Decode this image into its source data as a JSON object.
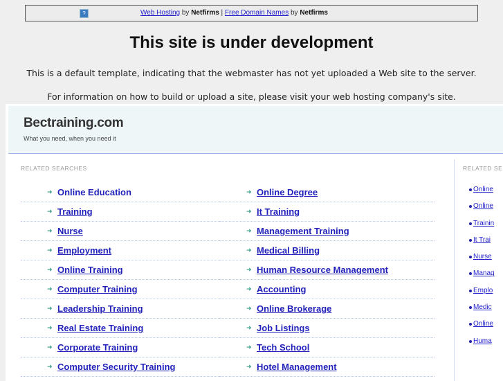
{
  "topbar": {
    "help_icon": "question-icon",
    "link1": "Web Hosting",
    "by1": " by ",
    "brand1": "Netfirms",
    "sep": " | ",
    "link2": "Free Domain Names",
    "by2": " by ",
    "brand2": "Netfirms"
  },
  "title": "This site is under development",
  "para1": "This is a default template, indicating that the webmaster has not yet uploaded a Web site to the server.",
  "para2": "For information on how to build or upload a site, please visit your web hosting company's site.",
  "site": {
    "name": "Bectraining.com",
    "tagline": "What you need, when you need it"
  },
  "related_label": "RELATED SEARCHES",
  "side_label": "RELATED SE",
  "left_col": [
    "Online Education",
    "Training",
    "Nurse",
    "Employment",
    "Online Training",
    "Computer Training",
    "Leadership Training",
    "Real Estate Training",
    "Corporate Training",
    "Computer Security Training"
  ],
  "right_col": [
    "Online Degree",
    "It Training",
    "Management Training",
    "Medical Billing",
    "Human Resource Management",
    "Accounting",
    "Online Brokerage",
    "Job Listings",
    "Tech School",
    "Hotel Management"
  ],
  "side_links": [
    "Online",
    "Online",
    "Trainin",
    "It Trai",
    "Nurse",
    "Manag",
    "Emplo",
    "Medic",
    "Online",
    "Huma"
  ]
}
